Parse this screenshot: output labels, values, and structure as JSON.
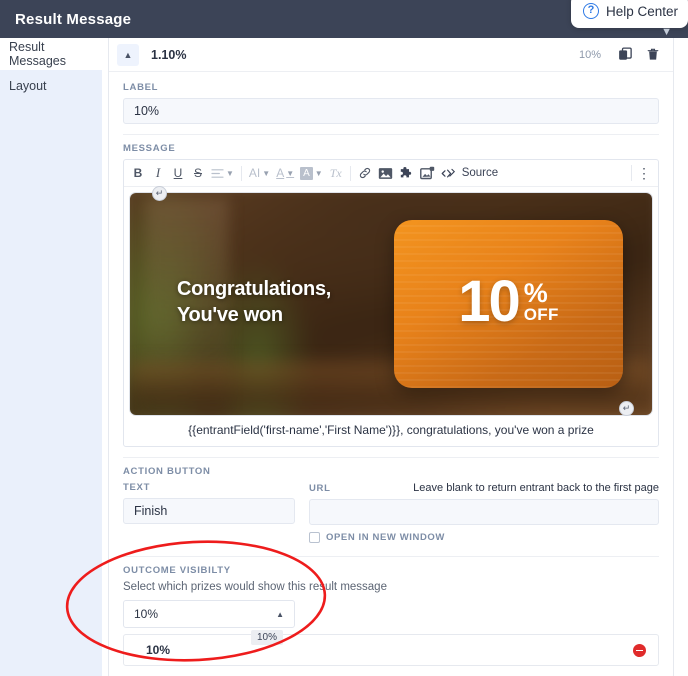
{
  "header": {
    "title": "Result Message",
    "help": {
      "label": "Help Center",
      "icon": "question-circle-icon"
    }
  },
  "sidebar": {
    "items": [
      {
        "label": "Result Messages",
        "active": true
      },
      {
        "label": "Layout",
        "active": false
      }
    ]
  },
  "card_head": {
    "collapse_icon": "chevron-up-icon",
    "percent": "1.10%",
    "right_percent": "10%",
    "duplicate_icon": "copy-icon",
    "delete_icon": "trash-icon"
  },
  "label_section": {
    "heading": "LABEL",
    "value": "10%"
  },
  "message_section": {
    "heading": "MESSAGE",
    "toolbar": {
      "bold": "B",
      "italic": "I",
      "underline": "U",
      "strikethrough": "S",
      "align": "align-icon",
      "font_size": "AI",
      "text_color": "A",
      "background_color": "A",
      "remove_format": "Tx",
      "link": "link-icon",
      "image": "image-icon",
      "merge_tag": "puzzle-icon",
      "media": "media-icon",
      "source_icon": "code-icon",
      "source_label": "Source",
      "more": "kebab-menu-icon"
    },
    "banner": {
      "headline": "Congratulations,\nYou've won",
      "promo_number": "10",
      "promo_percent": "%",
      "promo_off": "OFF"
    },
    "caption": "{{entrantField('first-name','First Name')}}, congratulations, you've won a prize"
  },
  "action_button": {
    "heading": "ACTION BUTTON",
    "text_label": "TEXT",
    "text_value": "Finish",
    "url_label": "URL",
    "url_hint": "Leave blank to return entrant back to the first page",
    "url_value": "",
    "new_window_label": "OPEN IN NEW WINDOW",
    "new_window_checked": false
  },
  "outcome_visibility": {
    "heading": "OUTCOME VISIBILTY",
    "description": "Select which prizes would show this result message",
    "select_value": "10%",
    "select_caret": "caret-up-icon",
    "tooltip": "10%",
    "rows": [
      {
        "label": "10%",
        "remove_icon": "remove-circle-icon"
      }
    ]
  },
  "annotation": {
    "shape": "ellipse",
    "color": "#ee1c1c"
  }
}
